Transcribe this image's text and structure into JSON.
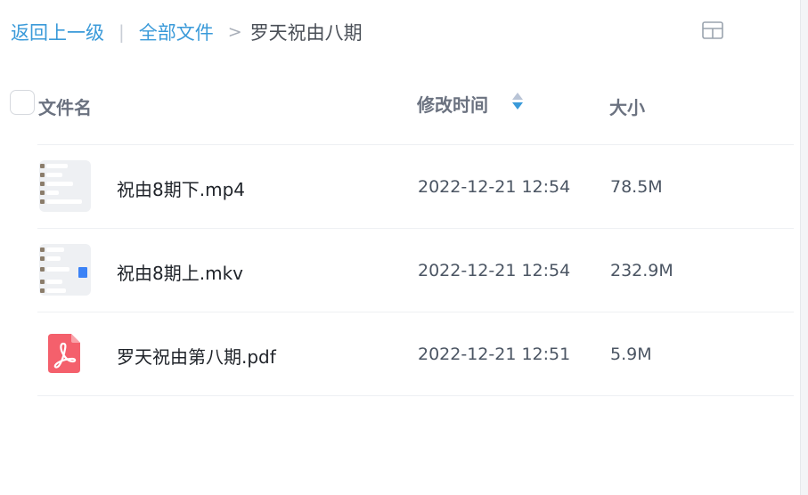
{
  "breadcrumb": {
    "back_label": "返回上一级",
    "separator_bar": "|",
    "all_files_label": "全部文件",
    "separator_arrow": ">",
    "current_label": "罗天祝由八期"
  },
  "toolbar": {
    "view_toggle_icon": "grid-view-icon"
  },
  "table": {
    "columns": {
      "name": "文件名",
      "modified": "修改时间",
      "size": "大小"
    },
    "sort_icon": "sort-arrows-icon",
    "accent_color": "#3a9ad9",
    "rows": [
      {
        "name": "祝由8期下.mp4",
        "modified": "2022-12-21 12:54",
        "size": "78.5M",
        "icon": "video-thumbnail"
      },
      {
        "name": "祝由8期上.mkv",
        "modified": "2022-12-21 12:54",
        "size": "232.9M",
        "icon": "video-thumbnail"
      },
      {
        "name": "罗天祝由第八期.pdf",
        "modified": "2022-12-21 12:51",
        "size": "5.9M",
        "icon": "pdf-icon"
      }
    ]
  },
  "colors": {
    "pdf_icon": "#f4606c",
    "sort_active": "#3a9ad9",
    "sort_inactive": "#b9c4d6"
  }
}
